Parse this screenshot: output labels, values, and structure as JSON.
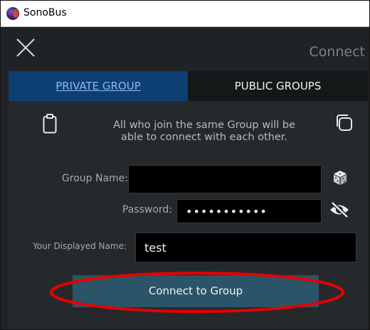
{
  "window": {
    "title": "SonoBus",
    "app_icon": "sonobus-logo-icon"
  },
  "header": {
    "close_icon": "close-icon",
    "connect_label": "Connect"
  },
  "tabs": [
    {
      "label": "PRIVATE GROUP",
      "active": true
    },
    {
      "label": "PUBLIC GROUPS",
      "active": false
    }
  ],
  "panel": {
    "info_line1": "All who join the same Group will be",
    "info_line2": "able to connect with each other.",
    "paste_icon": "clipboard-icon",
    "copy_icon": "copy-icon"
  },
  "form": {
    "group_name_label": "Group Name:",
    "group_name_value": "",
    "password_label": "Password:",
    "password_value": "•••••••••••",
    "display_name_label": "Your Displayed Name:",
    "display_name_value": "test",
    "dice_icon": "dice-icon",
    "eye_icon": "hide-password-icon"
  },
  "connect_button": {
    "label": "Connect to Group"
  },
  "colors": {
    "active_tab": "#0e3f73",
    "button": "#2b5468",
    "highlight": "#e60000"
  }
}
